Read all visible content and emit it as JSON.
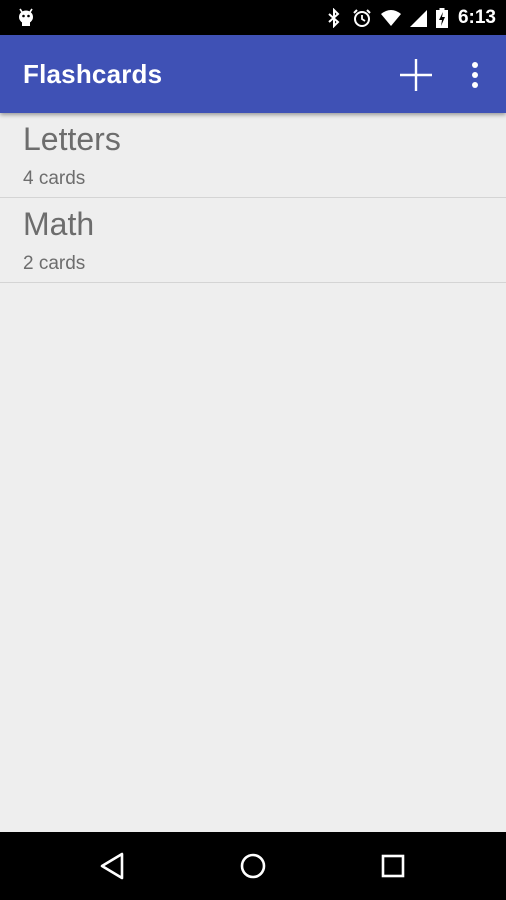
{
  "status_bar": {
    "time": "6:13",
    "icons": [
      "android-debug-icon",
      "bluetooth-icon",
      "alarm-icon",
      "wifi-icon",
      "signal-icon",
      "battery-charging-icon"
    ]
  },
  "app_bar": {
    "title": "Flashcards",
    "background_color": "#3f51b5",
    "actions": [
      "add-icon",
      "overflow-menu-icon"
    ]
  },
  "decks": [
    {
      "name": "Letters",
      "count": "4 cards"
    },
    {
      "name": "Math",
      "count": "2 cards"
    }
  ],
  "nav_bar": {
    "buttons": [
      "back-icon",
      "home-icon",
      "recents-icon"
    ]
  }
}
